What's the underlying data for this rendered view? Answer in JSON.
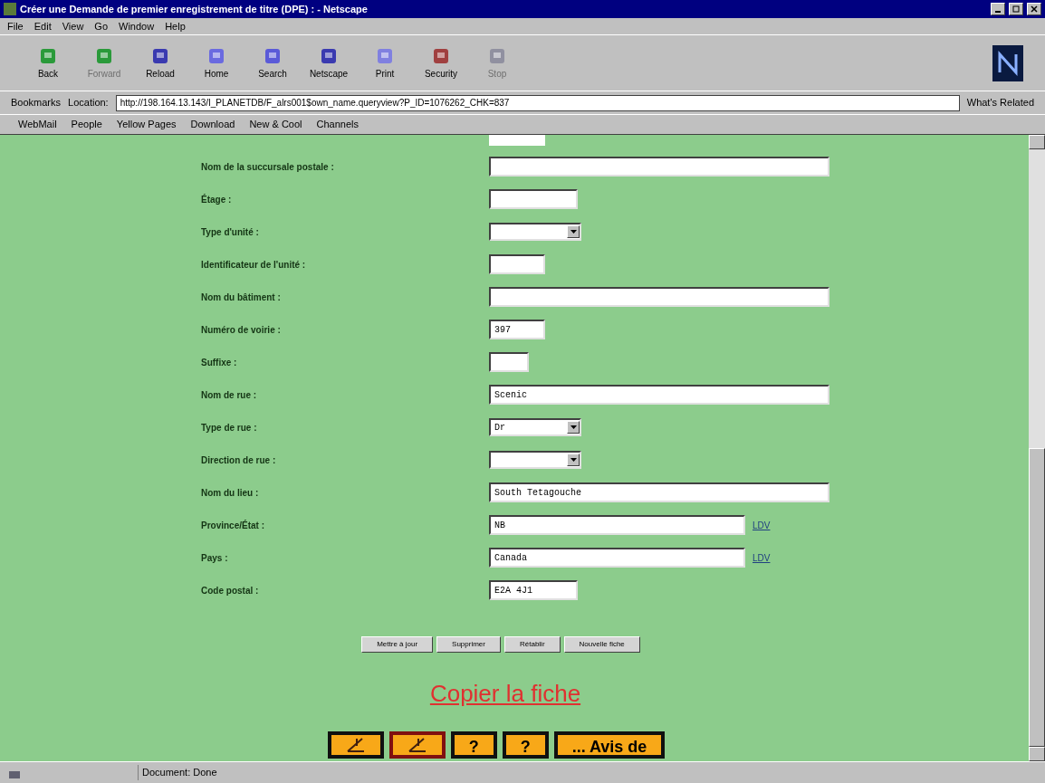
{
  "window": {
    "title": "Créer une Demande de premier enregistrement de titre (DPE) : - Netscape"
  },
  "menu": [
    "File",
    "Edit",
    "View",
    "Go",
    "Window",
    "Help"
  ],
  "toolbar": [
    {
      "label": "Back",
      "disabled": false
    },
    {
      "label": "Forward",
      "disabled": true
    },
    {
      "label": "Reload",
      "disabled": false
    },
    {
      "label": "Home",
      "disabled": false
    },
    {
      "label": "Search",
      "disabled": false
    },
    {
      "label": "Netscape",
      "disabled": false
    },
    {
      "label": "Print",
      "disabled": false
    },
    {
      "label": "Security",
      "disabled": false
    },
    {
      "label": "Stop",
      "disabled": true
    }
  ],
  "location": {
    "bookmarks": "Bookmarks",
    "label": "Location:",
    "url": "http://198.164.13.143/I_PLANETDB/F_alrs001$own_name.queryview?P_ID=1076262_CHK=837",
    "related": "What's Related"
  },
  "personal_toolbar": [
    "WebMail",
    "People",
    "Yellow Pages",
    "Download",
    "New & Cool",
    "Channels"
  ],
  "form": [
    {
      "label": "Nom de la succursale postale :",
      "kind": "text"
    },
    {
      "label": "Étage :",
      "kind": "text"
    },
    {
      "label": "Type d'unité :",
      "kind": "select"
    },
    {
      "label": "Identificateur de l'unité :",
      "kind": "text"
    },
    {
      "label": "Nom du bâtiment :",
      "kind": "text"
    },
    {
      "label": "Numéro de voirie :",
      "kind": "text",
      "value": "397"
    },
    {
      "label": "Suffixe :",
      "kind": "text"
    },
    {
      "label": "Nom de rue :",
      "kind": "text",
      "value": "Scenic"
    },
    {
      "label": "Type de rue :",
      "kind": "select",
      "value": "Dr"
    },
    {
      "label": "Direction de rue :",
      "kind": "select"
    },
    {
      "label": "Nom du lieu :",
      "kind": "text",
      "value": "South Tetagouche"
    },
    {
      "label": "Province/État :",
      "kind": "text",
      "value": "NB",
      "link": "LDV"
    },
    {
      "label": "Pays :",
      "kind": "text",
      "value": "Canada",
      "link": "LDV"
    },
    {
      "label": "Code postal :",
      "kind": "text",
      "value": "E2A 4J1"
    }
  ],
  "buttons": [
    "Mettre à jour",
    "Supprimer",
    "Rétablir",
    "Nouvelle fiche"
  ],
  "copy_link": "Copier la fiche",
  "nav_buttons": [
    {
      "kind": "icon"
    },
    {
      "kind": "icon-red"
    },
    {
      "kind": "text",
      "label": "?"
    },
    {
      "kind": "text",
      "label": "?"
    },
    {
      "kind": "text",
      "label": "... Avis de"
    }
  ],
  "status": "Document: Done"
}
